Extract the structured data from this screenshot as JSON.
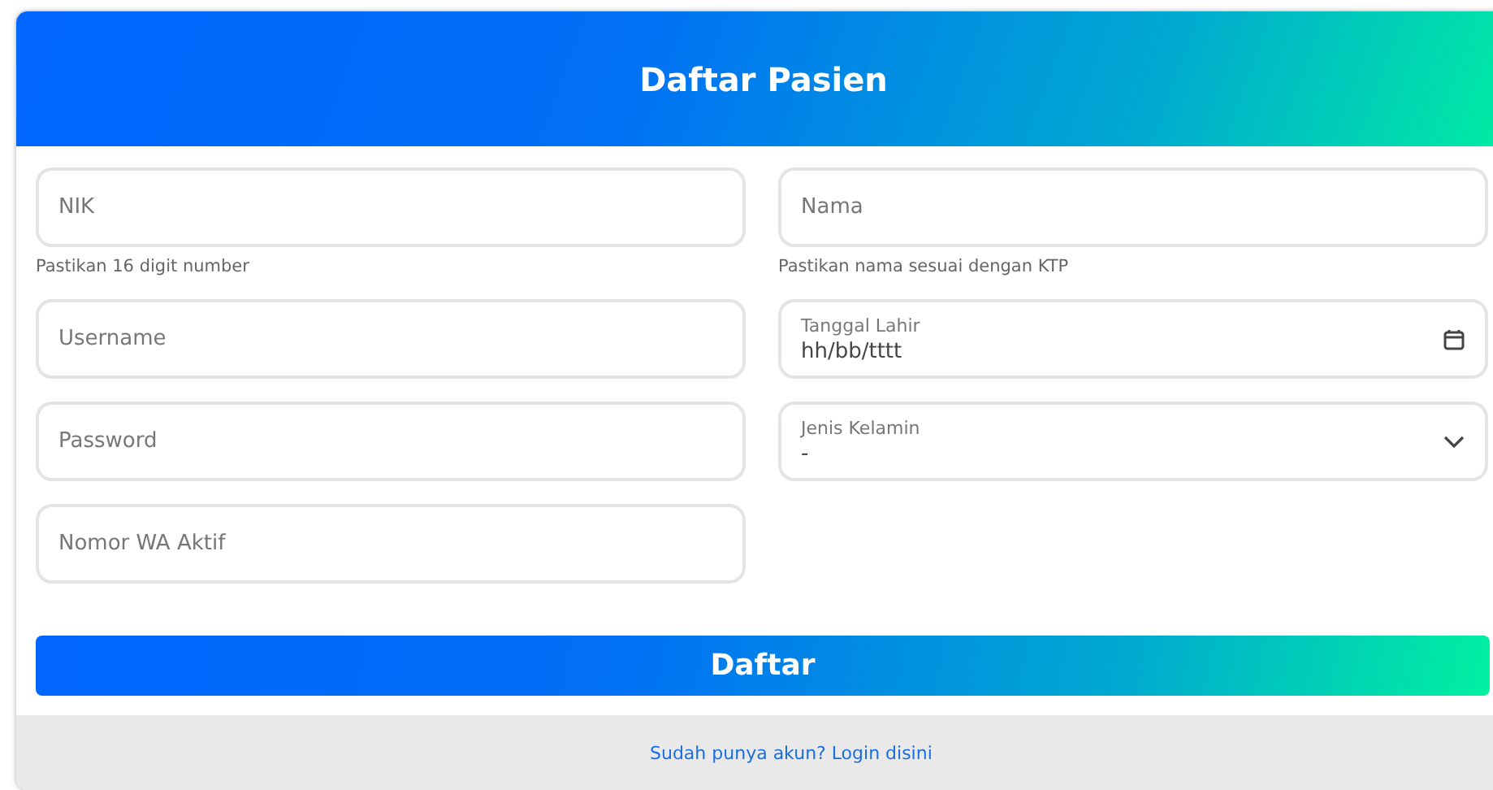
{
  "title": "Daftar Pasien",
  "fields": [
    {
      "kind": "text",
      "placeholder": "NIK",
      "hint": "Pastikan 16 digit number"
    },
    {
      "kind": "text",
      "placeholder": "Nama",
      "hint": "Pastikan nama sesuai dengan KTP"
    },
    {
      "kind": "text",
      "placeholder": "Username"
    },
    {
      "kind": "date",
      "label": "Tanggal Lahir",
      "value": "hh/bb/tttt"
    },
    {
      "kind": "text",
      "placeholder": "Password"
    },
    {
      "kind": "select",
      "label": "Jenis Kelamin",
      "value": "-"
    },
    {
      "kind": "text",
      "placeholder": "Nomor WA Aktif"
    }
  ],
  "submit": "Daftar",
  "footer_link": "Sudah punya akun? Login disini"
}
